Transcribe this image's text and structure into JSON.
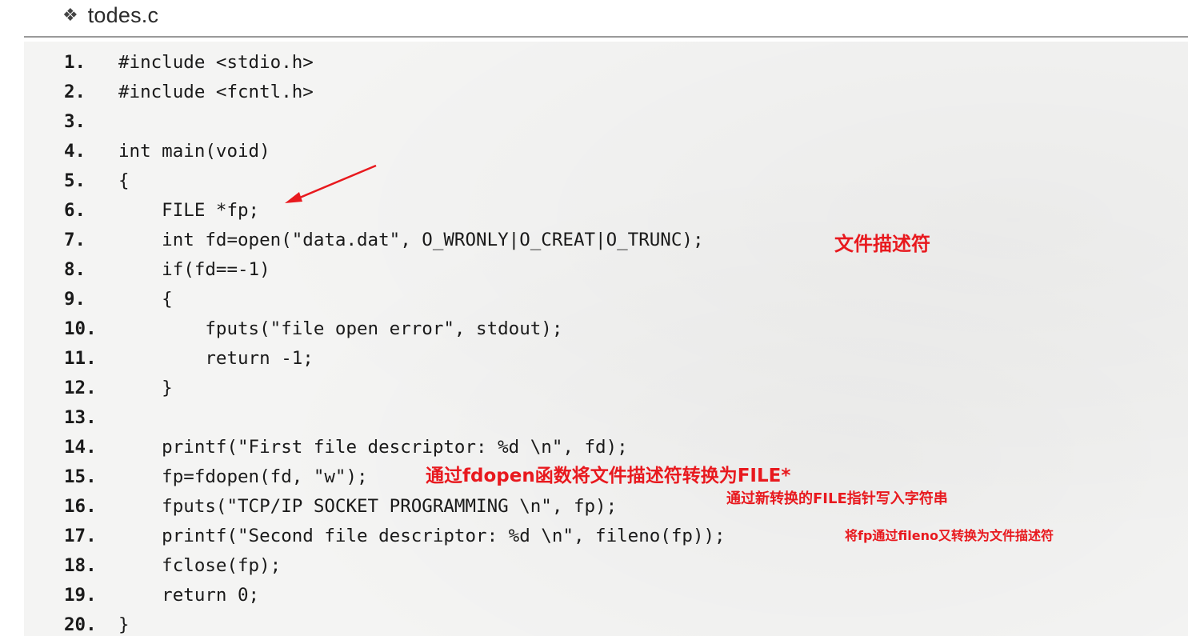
{
  "header": {
    "bullet_glyph": "❖",
    "title": "todes.c"
  },
  "code_lines": [
    {
      "num": "1.",
      "text": "#include <stdio.h>"
    },
    {
      "num": "2.",
      "text": "#include <fcntl.h>"
    },
    {
      "num": "3.",
      "text": ""
    },
    {
      "num": "4.",
      "text": "int main(void)"
    },
    {
      "num": "5.",
      "text": "{"
    },
    {
      "num": "6.",
      "text": "    FILE *fp;"
    },
    {
      "num": "7.",
      "text": "    int fd=open(\"data.dat\", O_WRONLY|O_CREAT|O_TRUNC);"
    },
    {
      "num": "8.",
      "text": "    if(fd==-1)"
    },
    {
      "num": "9.",
      "text": "    {"
    },
    {
      "num": "10.",
      "text": "        fputs(\"file open error\", stdout);"
    },
    {
      "num": "11.",
      "text": "        return -1;"
    },
    {
      "num": "12.",
      "text": "    }"
    },
    {
      "num": "13.",
      "text": ""
    },
    {
      "num": "14.",
      "text": "    printf(\"First file descriptor: %d \\n\", fd);"
    },
    {
      "num": "15.",
      "text": "    fp=fdopen(fd, \"w\");"
    },
    {
      "num": "16.",
      "text": "    fputs(\"TCP/IP SOCKET PROGRAMMING \\n\", fp);"
    },
    {
      "num": "17.",
      "text": "    printf(\"Second file descriptor: %d \\n\", fileno(fp));"
    },
    {
      "num": "18.",
      "text": "    fclose(fp);"
    },
    {
      "num": "19.",
      "text": "    return 0;"
    },
    {
      "num": "20.",
      "text": "}"
    }
  ],
  "annotations": {
    "line7": "文件描述符",
    "line15": "通过fdopen函数将文件描述符转换为FILE*",
    "line16": "通过新转换的FILE指针写入字符串",
    "line17": "将fp通过fileno又转换为文件描述符"
  },
  "colors": {
    "annotation": "#e8191e",
    "code_text": "#1a1a1a",
    "panel_bg": "#f4f4f3"
  }
}
